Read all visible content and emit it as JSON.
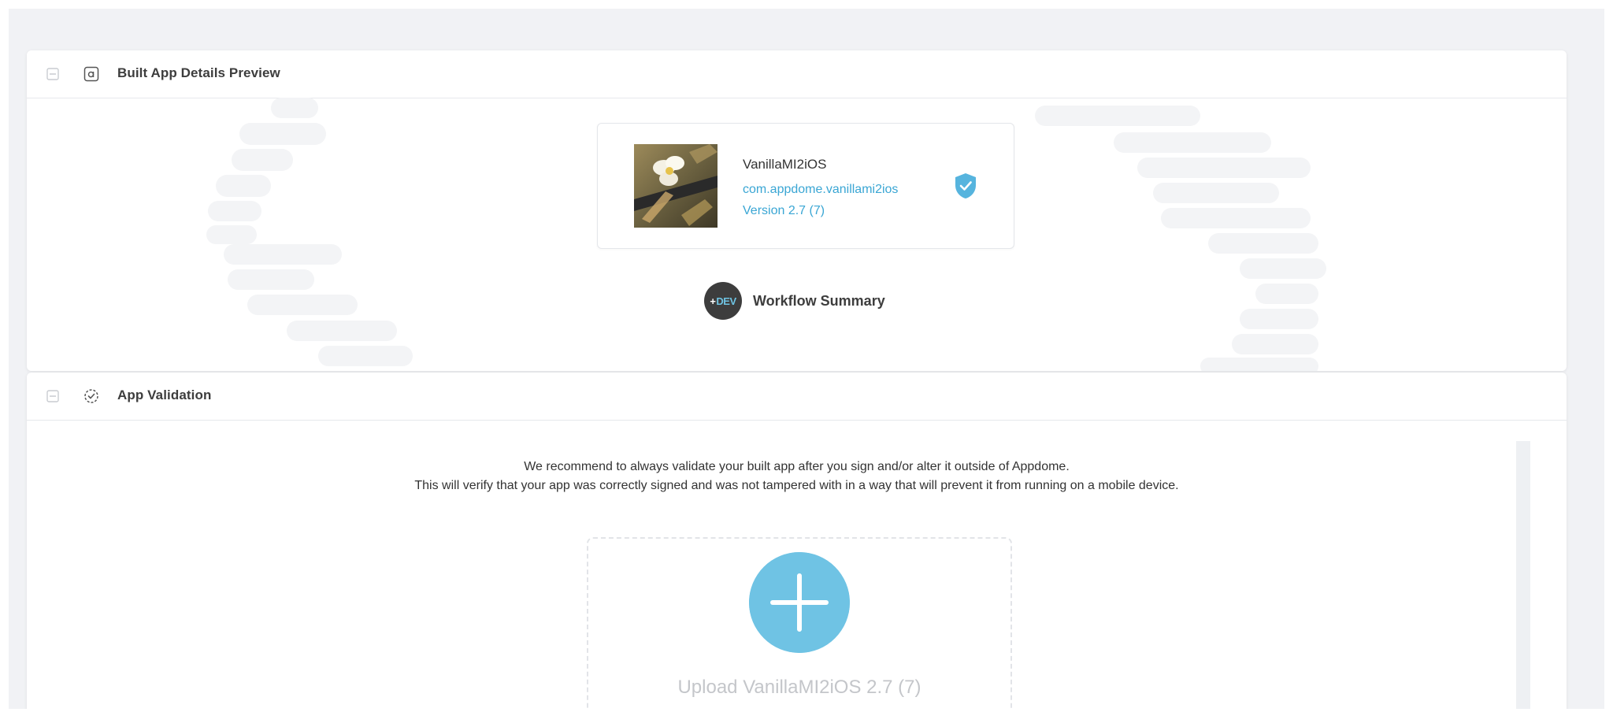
{
  "panels": {
    "details": {
      "title": "Built App Details Preview",
      "app": {
        "name": "VanillaMI2iOS",
        "bundle_id": "com.appdome.vanillami2ios",
        "version": "Version 2.7 (7)"
      },
      "workflow": {
        "badge_plus": "+",
        "badge_text": "DEV",
        "label": "Workflow Summary"
      }
    },
    "validation": {
      "title": "App Validation",
      "line1": "We recommend to always validate your built app after you sign and/or alter it outside of Appdome.",
      "line2": "This will verify that your app was correctly signed and was not tampered with in a way that will prevent it from running on a mobile device.",
      "upload_label": "Upload VanillaMI2iOS 2.7 (7)"
    }
  },
  "colors": {
    "accent": "#3aa6d4",
    "upload_circle": "#6fc3e4",
    "badge_dark": "#3d3d3d",
    "background": "#f1f2f5"
  },
  "icons": {
    "collapse": "collapse-icon",
    "details": "app-card-icon",
    "validation": "validation-check-icon",
    "verified": "shield-check-icon",
    "upload": "plus-icon"
  }
}
